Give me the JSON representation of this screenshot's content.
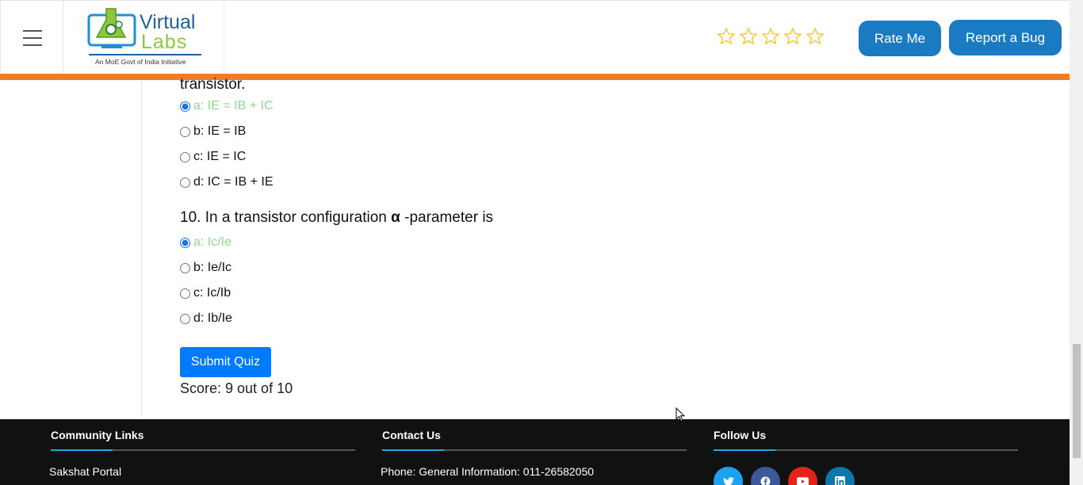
{
  "header": {
    "logo_top": "Virtual",
    "logo_bottom": "Labs",
    "logo_tagline": "An MoE Govt of India Initiative",
    "rate_label": "Rate Me",
    "bug_label": "Report a Bug",
    "stars_total": 5,
    "stars_filled": 0
  },
  "quiz": {
    "prev_question_tail": "transistor.",
    "prev_options": [
      {
        "label": "a: IE = IB + IC",
        "selected": true,
        "correct": true
      },
      {
        "label": "b: IE = IB",
        "selected": false,
        "correct": false
      },
      {
        "label": "c: IE = IC",
        "selected": false,
        "correct": false
      },
      {
        "label": "d: IC = IB + IE",
        "selected": false,
        "correct": false
      }
    ],
    "q10_prefix": "10. In a transistor configuration ",
    "q10_symbol": "α",
    "q10_suffix": " -parameter is",
    "q10_options": [
      {
        "label": "a: Ic/Ie",
        "selected": true,
        "correct": true
      },
      {
        "label": "b: Ie/Ic",
        "selected": false,
        "correct": false
      },
      {
        "label": "c: Ic/Ib",
        "selected": false,
        "correct": false
      },
      {
        "label": "d: Ib/Ie",
        "selected": false,
        "correct": false
      }
    ],
    "submit_label": "Submit Quiz",
    "score_text": "Score: 9 out of 10"
  },
  "footer": {
    "community_title": "Community Links",
    "community_item": "Sakshat Portal",
    "contact_title": "Contact Us",
    "contact_item": "Phone: General Information: 011-26582050",
    "follow_title": "Follow Us"
  },
  "colors": {
    "accent": "#1a7ac2",
    "orange": "#f47b20",
    "submit": "#007bff",
    "correct": "#8edc8e",
    "twitter": "#1da1f2",
    "facebook": "#3b5998",
    "youtube": "#e62117",
    "linkedin": "#0e76a8"
  }
}
